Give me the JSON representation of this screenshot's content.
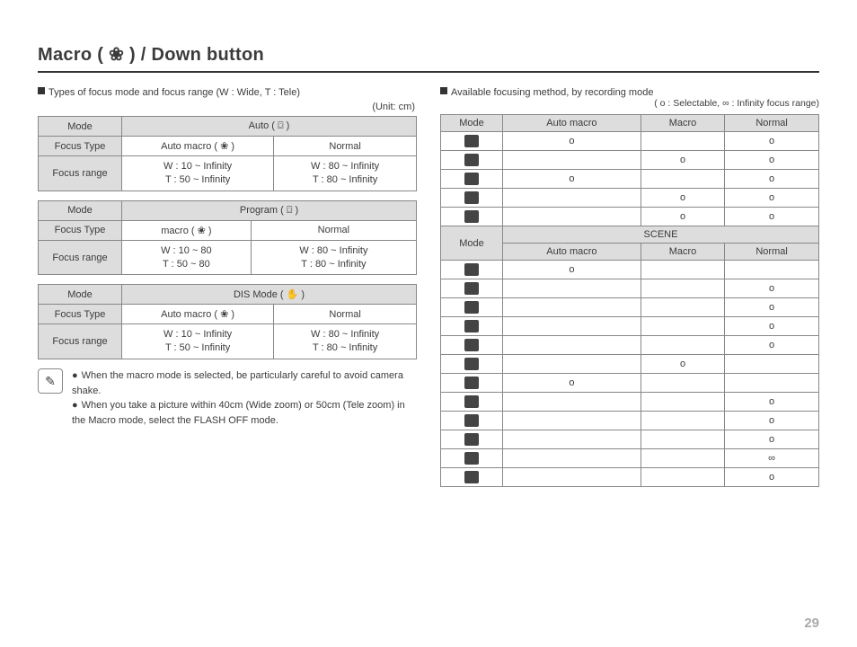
{
  "title": "Macro ( ❀ ) / Down button",
  "left": {
    "heading": "Types of focus mode and focus range (W : Wide, T : Tele)",
    "unit": "(Unit: cm)",
    "tables": [
      {
        "modeLabel": "Mode",
        "modeValue": "Auto (  ⌼  )",
        "focusTypeLabel": "Focus Type",
        "focusTypeA": "Auto macro ( ❀ )",
        "focusTypeB": "Normal",
        "focusRangeLabel": "Focus range",
        "rangeA": "W : 10 ~ Infinity\nT  : 50 ~ Infinity",
        "rangeB": "W : 80 ~ Infinity\nT  : 80 ~ Infinity"
      },
      {
        "modeLabel": "Mode",
        "modeValue": "Program (  ⌼  )",
        "focusTypeLabel": "Focus Type",
        "focusTypeA": "macro ( ❀ )",
        "focusTypeB": "Normal",
        "focusRangeLabel": "Focus range",
        "rangeA": "W : 10 ~ 80\nT  : 50 ~ 80",
        "rangeB": "W : 80 ~ Infinity\nT  : 80 ~ Infinity"
      },
      {
        "modeLabel": "Mode",
        "modeValue": "DIS Mode (  ✋  )",
        "focusTypeLabel": "Focus Type",
        "focusTypeA": "Auto macro ( ❀ )",
        "focusTypeB": "Normal",
        "focusRangeLabel": "Focus range",
        "rangeA": "W : 10 ~ Infinity\nT  : 50 ~ Infinity",
        "rangeB": "W : 80 ~ Infinity\nT  : 80 ~ Infinity"
      }
    ],
    "notes": [
      "When the macro mode is selected, be particularly careful to avoid camera shake.",
      "When you take a picture within 40cm (Wide zoom) or 50cm (Tele zoom) in the Macro mode, select the FLASH OFF mode."
    ]
  },
  "right": {
    "heading": "Available focusing method, by recording mode",
    "legend": "( o : Selectable, ∞ : Infinity focus range)",
    "headers": {
      "mode": "Mode",
      "am": "Auto macro",
      "m": "Macro",
      "n": "Normal",
      "scene": "SCENE"
    },
    "topRows": [
      {
        "am": "o",
        "m": "",
        "n": "o"
      },
      {
        "am": "",
        "m": "o",
        "n": "o"
      },
      {
        "am": "o",
        "m": "",
        "n": "o"
      },
      {
        "am": "",
        "m": "o",
        "n": "o"
      },
      {
        "am": "",
        "m": "o",
        "n": "o"
      }
    ],
    "sceneRows": [
      {
        "am": "o",
        "m": "",
        "n": ""
      },
      {
        "am": "",
        "m": "",
        "n": "o"
      },
      {
        "am": "",
        "m": "",
        "n": "o"
      },
      {
        "am": "",
        "m": "",
        "n": "o"
      },
      {
        "am": "",
        "m": "",
        "n": "o"
      },
      {
        "am": "",
        "m": "o",
        "n": ""
      },
      {
        "am": "o",
        "m": "",
        "n": ""
      },
      {
        "am": "",
        "m": "",
        "n": "o"
      },
      {
        "am": "",
        "m": "",
        "n": "o"
      },
      {
        "am": "",
        "m": "",
        "n": "o"
      },
      {
        "am": "",
        "m": "",
        "n": "∞"
      },
      {
        "am": "",
        "m": "",
        "n": "o"
      }
    ]
  },
  "page": "29"
}
